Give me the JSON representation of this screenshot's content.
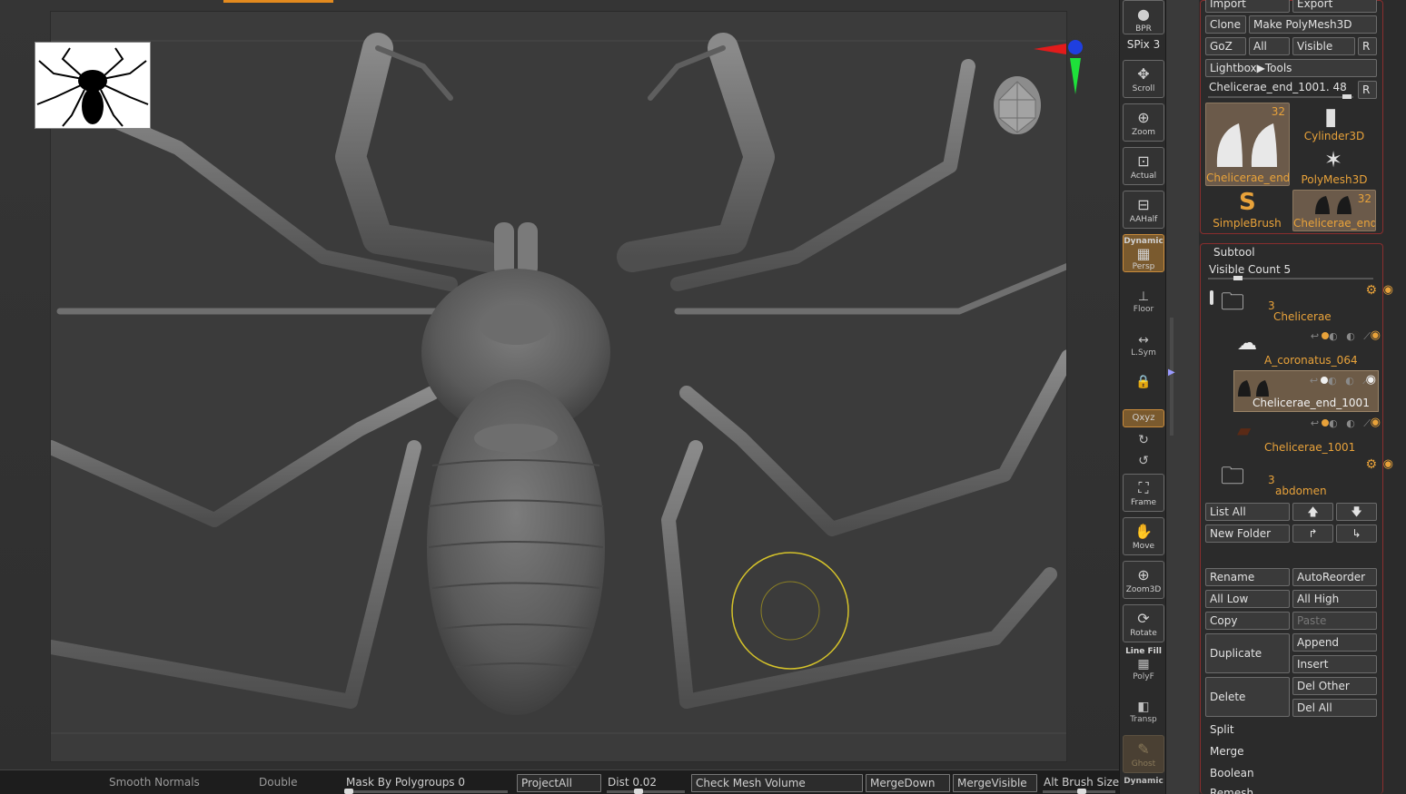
{
  "viewport": {
    "thumbnail_alt": "whip spider reference silhouette",
    "brush_cursor": "draw-size-ring"
  },
  "bottom_bar": {
    "smooth_normals": "Smooth Normals",
    "double": "Double",
    "mask_by_polygroups": "Mask By Polygroups 0",
    "project_all": "ProjectAll",
    "dist": "Dist 0.02",
    "check_mesh_volume": "Check Mesh Volume",
    "merge_down": "MergeDown",
    "merge_visible": "MergeVisible",
    "alt_brush_size": "Alt Brush Size"
  },
  "shelf": {
    "bpr": "BPR",
    "spix": "SPix 3",
    "scroll": "Scroll",
    "zoom": "Zoom",
    "actual": "Actual",
    "aahalf": "AAHalf",
    "dynamic": "Dynamic",
    "persp": "Persp",
    "floor": "Floor",
    "lsym": "L.Sym",
    "xyz": "Qxyz",
    "frame": "Frame",
    "move": "Move",
    "zoom3d": "Zoom3D",
    "rotate": "Rotate",
    "line_fill": "Line Fill",
    "polyf": "PolyF",
    "transp": "Transp",
    "ghost": "Ghost",
    "dynamic2": "Dynamic"
  },
  "tool": {
    "import": "Import",
    "export": "Export",
    "clone": "Clone",
    "make_polymesh": "Make PolyMesh3D",
    "goz": "GoZ",
    "all": "All",
    "visible": "Visible",
    "r": "R",
    "lightbox_tools": "Lightbox▶Tools",
    "current_tool": "Chelicerae_end_1001. 48",
    "r2": "R",
    "tiles": [
      {
        "name": "Chelicerae_end",
        "count": "32"
      },
      {
        "name": "Cylinder3D",
        "count": ""
      },
      {
        "name": "PolyMesh3D",
        "count": ""
      },
      {
        "name": "SimpleBrush",
        "count": ""
      },
      {
        "name": "Chelicerae_end_",
        "count": "32"
      }
    ]
  },
  "subtool": {
    "title": "Subtool",
    "visible_count": "Visible Count 5",
    "items": [
      {
        "name": "Chelicerae",
        "count": "3",
        "kind": "folder"
      },
      {
        "name": "A_coronatus_064",
        "kind": "mesh"
      },
      {
        "name": "Chelicerae_end_1001",
        "kind": "mesh",
        "selected": true
      },
      {
        "name": "Chelicerae_1001",
        "kind": "mesh"
      },
      {
        "name": "abdomen",
        "count": "3",
        "kind": "folder"
      }
    ],
    "list_all": "List All",
    "new_folder": "New Folder",
    "rename": "Rename",
    "auto_reorder": "AutoReorder",
    "all_low": "All Low",
    "all_high": "All High",
    "copy": "Copy",
    "paste": "Paste",
    "duplicate": "Duplicate",
    "append": "Append",
    "insert": "Insert",
    "delete": "Delete",
    "del_other": "Del Other",
    "del_all": "Del All",
    "split": "Split",
    "merge": "Merge",
    "boolean": "Boolean",
    "remesh": "Remesh"
  },
  "colors": {
    "accent": "#e8a23a",
    "frame_red": "#8a2e2e",
    "selected_row": "#6d5b47",
    "brush_ring": "#d4c22a"
  }
}
